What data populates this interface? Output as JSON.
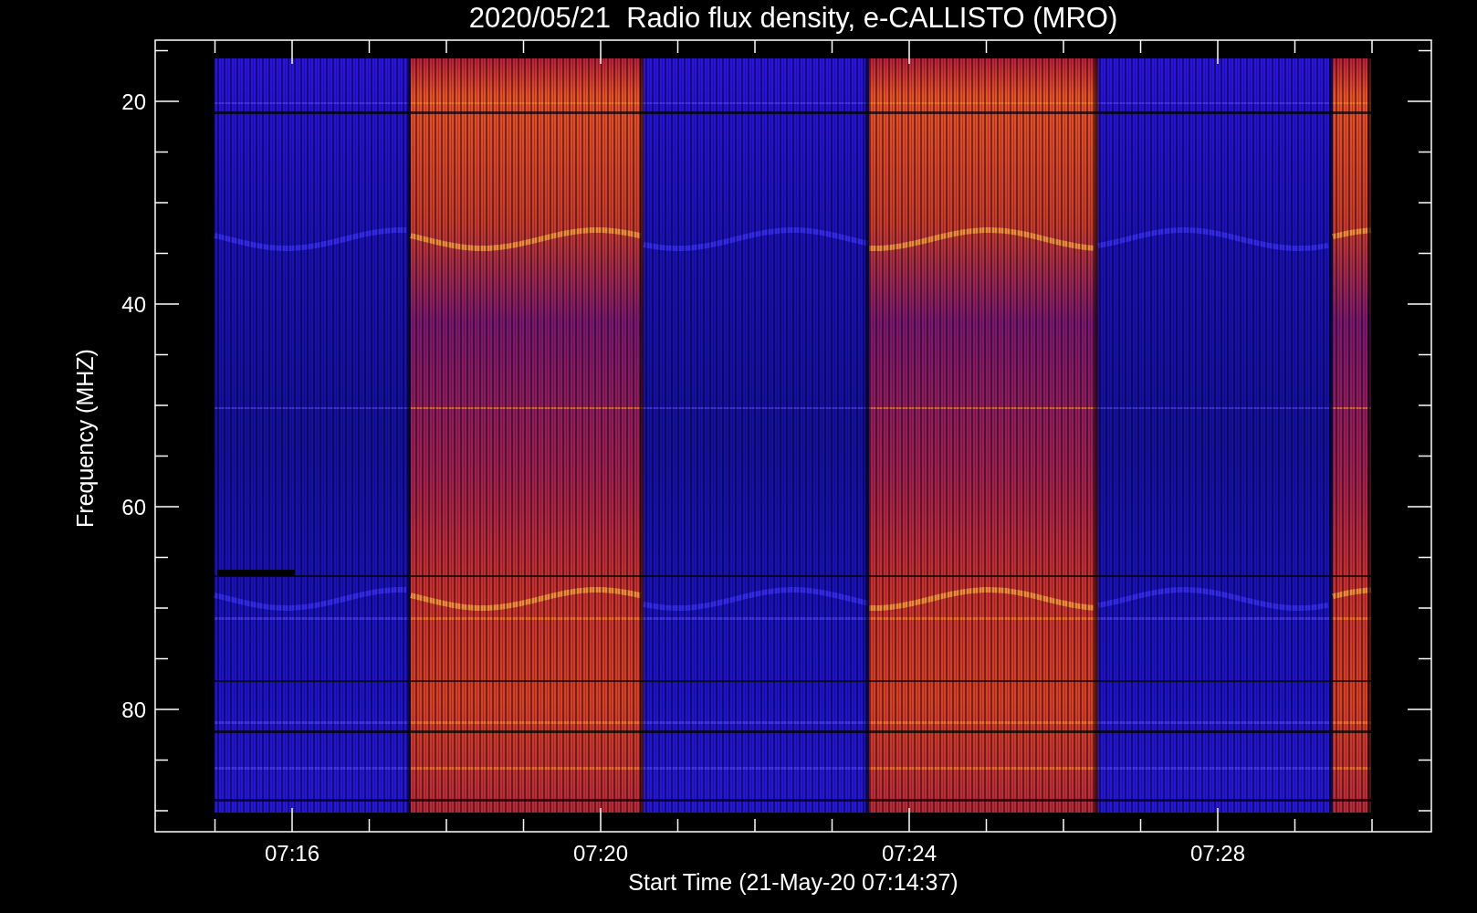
{
  "title": "2020/05/21  Radio flux density, e-CALLISTO (MRO)",
  "plot": {
    "xlabel": "Start Time (21-May-20 07:14:37)",
    "ylabel": "Frequency (MHZ)",
    "xticks": [
      "07:16",
      "07:20",
      "07:24",
      "07:28"
    ],
    "yticks": [
      "20",
      "40",
      "60",
      "80"
    ]
  }
}
